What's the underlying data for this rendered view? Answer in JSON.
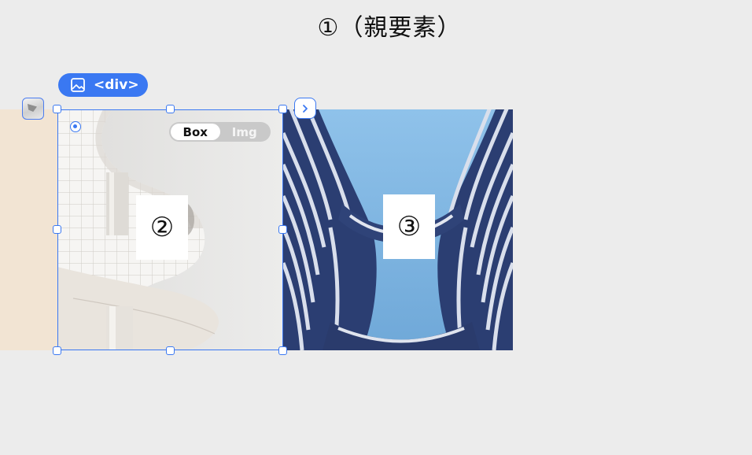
{
  "parent_label": "①（親要素）",
  "element_tag": {
    "label": "<div>",
    "icon": "image-icon"
  },
  "toggle": {
    "options": [
      "Box",
      "Img"
    ],
    "selected": "Box"
  },
  "child_labels": {
    "selected_image": "②",
    "next_image": "③"
  },
  "icons": {
    "next": "chevron-right-icon",
    "rotate": "rotate-handle-icon",
    "thumbnail": "image-thumbnail-icon"
  },
  "colors": {
    "accent": "#3a78f2",
    "background": "#ececec",
    "peach": "#f2e4d3"
  }
}
